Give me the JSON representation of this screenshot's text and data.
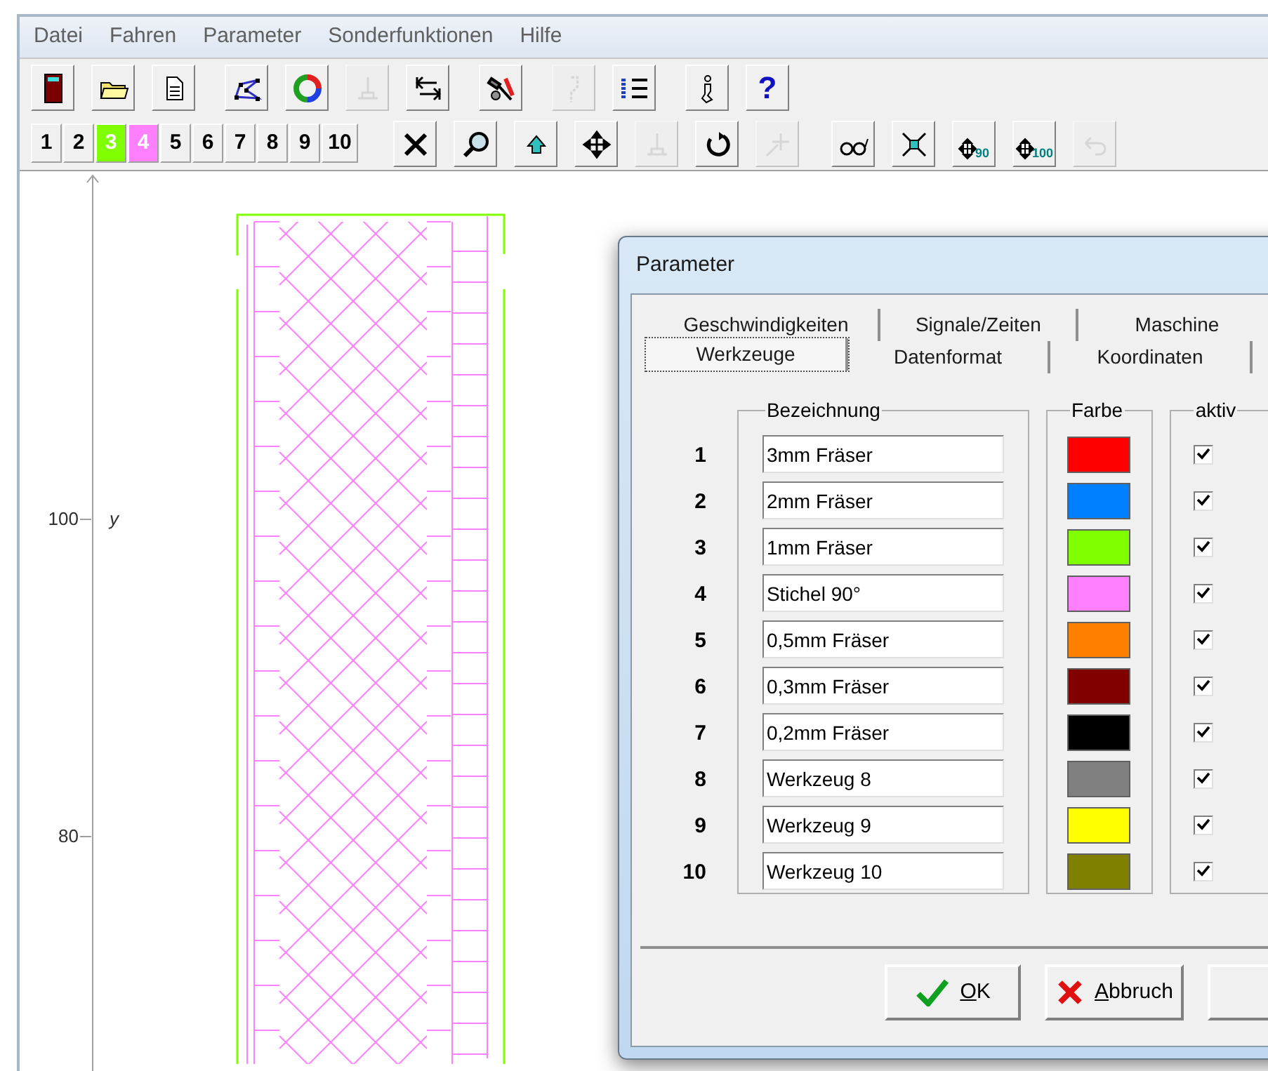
{
  "menu": [
    {
      "label": "Datei"
    },
    {
      "label": "Fahren"
    },
    {
      "label": "Parameter"
    },
    {
      "label": "Sonderfunktionen"
    },
    {
      "label": "Hilfe"
    }
  ],
  "toolbar": [
    [
      {
        "kind": "door",
        "disabled": false
      },
      {
        "kind": "folder",
        "disabled": false
      },
      {
        "kind": "document",
        "disabled": false
      }
    ],
    [
      {
        "kind": "polygon",
        "disabled": false
      },
      {
        "kind": "cycle",
        "disabled": false
      },
      {
        "kind": "pin",
        "disabled": true
      },
      {
        "kind": "arrows",
        "disabled": false
      }
    ],
    [
      {
        "kind": "hammer",
        "disabled": false
      }
    ],
    [
      {
        "kind": "hook",
        "disabled": true
      },
      {
        "kind": "list",
        "disabled": false
      }
    ],
    [
      {
        "kind": "info",
        "disabled": false
      },
      {
        "kind": "help",
        "label": "?",
        "disabled": false
      }
    ]
  ],
  "tool_numbers": [
    {
      "label": "1"
    },
    {
      "label": "2"
    },
    {
      "label": "3",
      "color": "#80ff00"
    },
    {
      "label": "4",
      "color": "#ff80ff"
    },
    {
      "label": "5"
    },
    {
      "label": "6"
    },
    {
      "label": "7"
    },
    {
      "label": "8"
    },
    {
      "label": "9"
    },
    {
      "label": "10"
    }
  ],
  "view_toolbar": [
    [
      {
        "kind": "close",
        "disabled": false
      },
      {
        "kind": "search",
        "disabled": false
      },
      {
        "kind": "up",
        "disabled": false
      },
      {
        "kind": "move",
        "disabled": false
      },
      {
        "kind": "pin",
        "disabled": true
      },
      {
        "kind": "rotate",
        "disabled": false
      },
      {
        "kind": "crosshair",
        "disabled": true
      }
    ],
    [
      {
        "kind": "glasses",
        "disabled": false
      },
      {
        "kind": "shrink",
        "disabled": false
      },
      {
        "kind": "move-label",
        "label": "90",
        "disabled": false
      },
      {
        "kind": "move-label",
        "label": "100",
        "disabled": false
      },
      {
        "kind": "undo",
        "disabled": true
      }
    ]
  ],
  "canvas": {
    "axis_label": "y",
    "ticks": [
      {
        "label": "100"
      },
      {
        "label": "80"
      }
    ]
  },
  "dialog": {
    "title": "Parameter",
    "tab_rows": [
      [
        {
          "label": "Geschwindigkeiten",
          "selected": false
        },
        {
          "label": "Signale/Zeiten",
          "selected": false
        },
        {
          "label": "Maschine",
          "selected": false
        }
      ],
      [
        {
          "label": "Werkzeuge",
          "selected": true
        },
        {
          "label": "Datenformat",
          "selected": false
        },
        {
          "label": "Koordinaten",
          "selected": false
        }
      ]
    ],
    "group_titles": [
      "Bezeichnung",
      "Farbe",
      "aktiv"
    ],
    "tools": [
      {
        "number": "1",
        "name": "3mm Fräser",
        "color": "#ff0000",
        "active": true
      },
      {
        "number": "2",
        "name": "2mm Fräser",
        "color": "#0080ff",
        "active": true
      },
      {
        "number": "3",
        "name": "1mm Fräser",
        "color": "#80ff00",
        "active": true
      },
      {
        "number": "4",
        "name": "Stichel 90°",
        "color": "#ff80ff",
        "active": true
      },
      {
        "number": "5",
        "name": "0,5mm Fräser",
        "color": "#ff8000",
        "active": true
      },
      {
        "number": "6",
        "name": "0,3mm Fräser",
        "color": "#800000",
        "active": true
      },
      {
        "number": "7",
        "name": "0,2mm Fräser",
        "color": "#000000",
        "active": true
      },
      {
        "number": "8",
        "name": "Werkzeug 8",
        "color": "#808080",
        "active": true
      },
      {
        "number": "9",
        "name": "Werkzeug 9",
        "color": "#ffff00",
        "active": true
      },
      {
        "number": "10",
        "name": "Werkzeug 10",
        "color": "#808000",
        "active": true
      }
    ],
    "buttons": [
      {
        "kind": "ok",
        "label": "OK"
      },
      {
        "kind": "cancel",
        "label": "Abbruch"
      }
    ]
  }
}
